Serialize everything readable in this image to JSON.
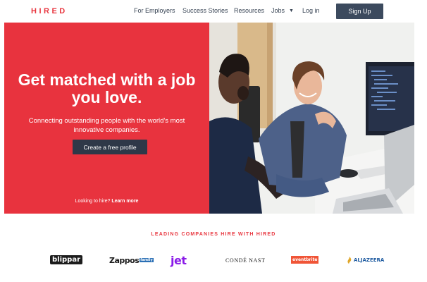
{
  "nav": {
    "logo": "HIRED",
    "links": [
      {
        "label": "For Employers"
      },
      {
        "label": "Success Stories"
      },
      {
        "label": "Resources"
      },
      {
        "label": "Jobs"
      },
      {
        "label": "Log in"
      }
    ],
    "signup_label": "Sign Up",
    "jobs_icon": "chevron-down-icon"
  },
  "hero": {
    "headline": "Get matched with a job you love.",
    "subline": "Connecting outstanding people with the world's most innovative companies.",
    "cta_label": "Create a free profile",
    "hire_prefix": "Looking to hire?",
    "hire_link": "Learn more",
    "accent_color": "#e8333e"
  },
  "companies": {
    "title": "LEADING COMPANIES HIRE WITH HIRED",
    "logos": [
      {
        "name": "blippar",
        "text": "blippar"
      },
      {
        "name": "zappos",
        "text": "Zappos",
        "badge": "family"
      },
      {
        "name": "jet",
        "text": "jet"
      },
      {
        "name": "conde-nast",
        "text": "CONDÉ NAST"
      },
      {
        "name": "eventbrite",
        "text": "eventbrite"
      },
      {
        "name": "aljazeera",
        "text": "ALJAZEERA"
      }
    ]
  }
}
